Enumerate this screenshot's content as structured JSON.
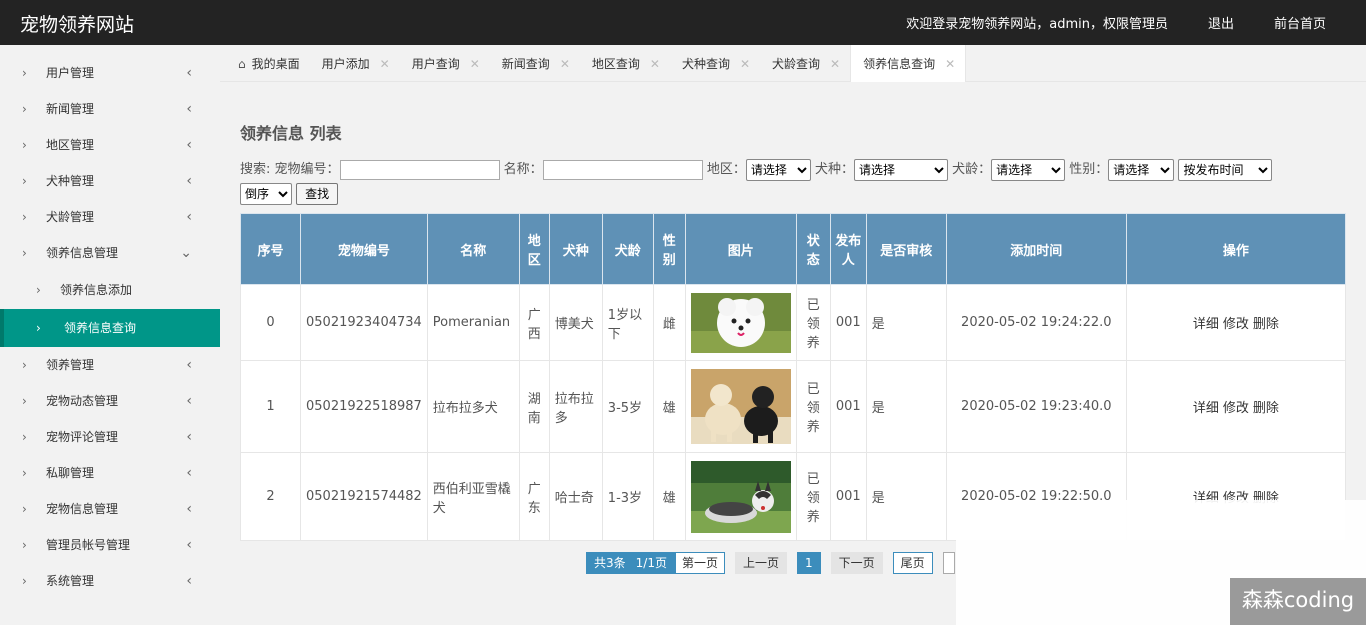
{
  "header": {
    "brand": "宠物领养网站",
    "welcome": "欢迎登录宠物领养网站，admin，权限管理员",
    "logout": "退出",
    "front": "前台首页"
  },
  "sidebar": {
    "items": [
      {
        "label": "用户管理"
      },
      {
        "label": "新闻管理"
      },
      {
        "label": "地区管理"
      },
      {
        "label": "犬种管理"
      },
      {
        "label": "犬龄管理"
      },
      {
        "label": "领养信息管理"
      },
      {
        "label": "领养信息添加"
      },
      {
        "label": "领养信息查询"
      },
      {
        "label": "领养管理"
      },
      {
        "label": "宠物动态管理"
      },
      {
        "label": "宠物评论管理"
      },
      {
        "label": "私聊管理"
      },
      {
        "label": "宠物信息管理"
      },
      {
        "label": "管理员帐号管理"
      },
      {
        "label": "系统管理"
      }
    ]
  },
  "tabs": [
    {
      "label": "我的桌面"
    },
    {
      "label": "用户添加"
    },
    {
      "label": "用户查询"
    },
    {
      "label": "新闻查询"
    },
    {
      "label": "地区查询"
    },
    {
      "label": "犬种查询"
    },
    {
      "label": "犬龄查询"
    },
    {
      "label": "领养信息查询"
    }
  ],
  "page": {
    "title": "领养信息 列表"
  },
  "search": {
    "label_prefix": "搜索: 宠物编号：",
    "name_label": "名称：",
    "region_label": "地区：",
    "breed_label": "犬种：",
    "age_label": "犬龄：",
    "gender_label": "性别：",
    "select_default": "请选择",
    "sort_field": "按发布时间",
    "sort_order": "倒序",
    "find_button": "查找"
  },
  "table": {
    "headers": [
      "序号",
      "宠物编号",
      "名称",
      "地区",
      "犬种",
      "犬龄",
      "性别",
      "图片",
      "状态",
      "发布人",
      "是否审核",
      "添加时间",
      "操作"
    ],
    "rows": [
      {
        "idx": "0",
        "code": "05021923404734",
        "name": "Pomeranian",
        "region": "广西",
        "breed": "博美犬",
        "age": "1岁以下",
        "gender": "雌",
        "status": "已领养",
        "publisher": "001",
        "audited": "是",
        "time": "2020-05-02 19:24:22.0"
      },
      {
        "idx": "1",
        "code": "05021922518987",
        "name": "拉布拉多犬",
        "region": "湖南",
        "breed": "拉布拉多",
        "age": "3-5岁",
        "gender": "雄",
        "status": "已领养",
        "publisher": "001",
        "audited": "是",
        "time": "2020-05-02 19:23:40.0"
      },
      {
        "idx": "2",
        "code": "05021921574482",
        "name": "西伯利亚雪橇犬",
        "region": "广东",
        "breed": "哈士奇",
        "age": "1-3岁",
        "gender": "雄",
        "status": "已领养",
        "publisher": "001",
        "audited": "是",
        "time": "2020-05-02 19:22:50.0"
      }
    ],
    "ops": {
      "detail": "详细",
      "edit": "修改",
      "delete": "删除"
    }
  },
  "pager": {
    "total": "共3条",
    "pages": "1/1页",
    "first": "第一页",
    "prev": "上一页",
    "current": "1",
    "next": "下一页",
    "last": "尾页"
  },
  "watermark": "森森coding"
}
